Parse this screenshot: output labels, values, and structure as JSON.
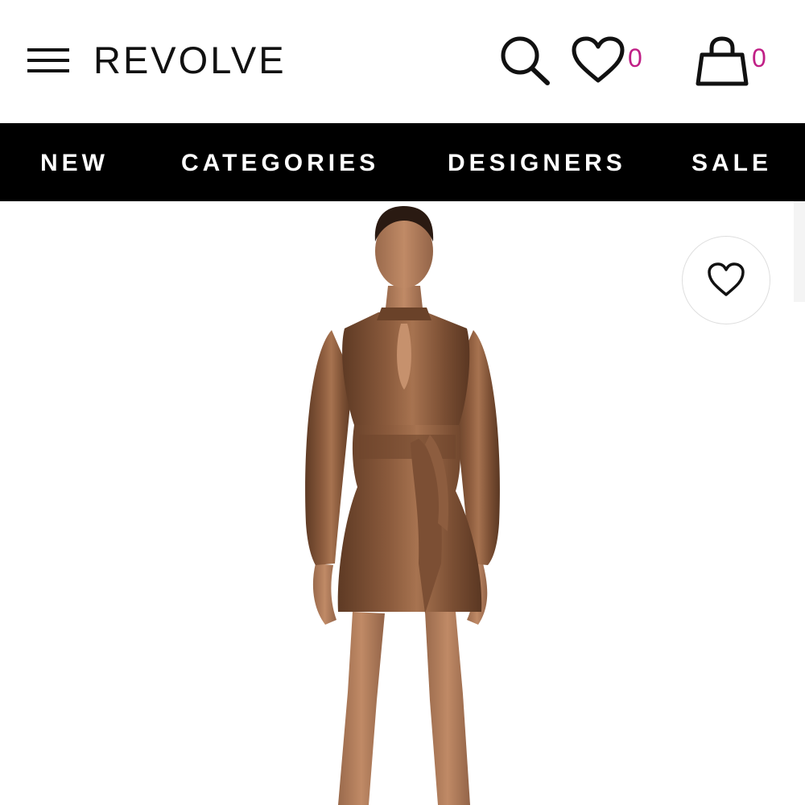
{
  "header": {
    "brand": "REVOLVE",
    "wishlist_count": "0",
    "bag_count": "0",
    "icons": {
      "menu": "hamburger-menu-icon",
      "search": "search-icon",
      "wishlist": "heart-icon",
      "bag": "shopping-bag-icon"
    },
    "count_color": "#c01f86"
  },
  "nav": {
    "items": [
      {
        "label": "NEW"
      },
      {
        "label": "CATEGORIES"
      },
      {
        "label": "DESIGNERS"
      },
      {
        "label": "SALE"
      }
    ],
    "background": "#000000",
    "text_color": "#ffffff"
  },
  "product": {
    "favorite_icon": "heart-outline-icon",
    "dress_color": "#7a4e33"
  }
}
